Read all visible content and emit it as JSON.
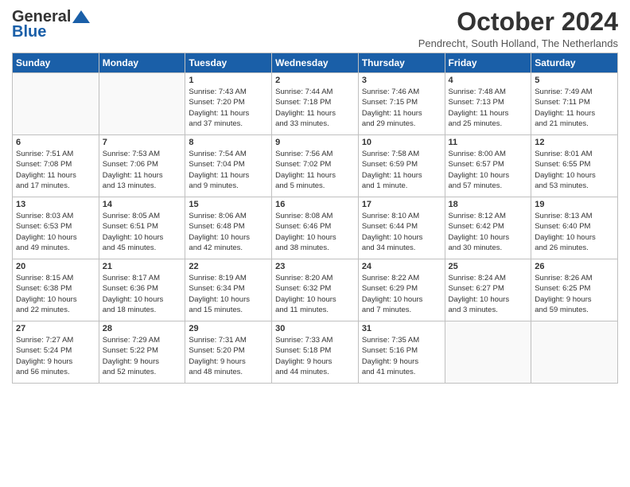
{
  "header": {
    "logo_general": "General",
    "logo_blue": "Blue",
    "month_title": "October 2024",
    "location": "Pendrecht, South Holland, The Netherlands"
  },
  "weekdays": [
    "Sunday",
    "Monday",
    "Tuesday",
    "Wednesday",
    "Thursday",
    "Friday",
    "Saturday"
  ],
  "weeks": [
    [
      {
        "day": "",
        "info": ""
      },
      {
        "day": "",
        "info": ""
      },
      {
        "day": "1",
        "info": "Sunrise: 7:43 AM\nSunset: 7:20 PM\nDaylight: 11 hours\nand 37 minutes."
      },
      {
        "day": "2",
        "info": "Sunrise: 7:44 AM\nSunset: 7:18 PM\nDaylight: 11 hours\nand 33 minutes."
      },
      {
        "day": "3",
        "info": "Sunrise: 7:46 AM\nSunset: 7:15 PM\nDaylight: 11 hours\nand 29 minutes."
      },
      {
        "day": "4",
        "info": "Sunrise: 7:48 AM\nSunset: 7:13 PM\nDaylight: 11 hours\nand 25 minutes."
      },
      {
        "day": "5",
        "info": "Sunrise: 7:49 AM\nSunset: 7:11 PM\nDaylight: 11 hours\nand 21 minutes."
      }
    ],
    [
      {
        "day": "6",
        "info": "Sunrise: 7:51 AM\nSunset: 7:08 PM\nDaylight: 11 hours\nand 17 minutes."
      },
      {
        "day": "7",
        "info": "Sunrise: 7:53 AM\nSunset: 7:06 PM\nDaylight: 11 hours\nand 13 minutes."
      },
      {
        "day": "8",
        "info": "Sunrise: 7:54 AM\nSunset: 7:04 PM\nDaylight: 11 hours\nand 9 minutes."
      },
      {
        "day": "9",
        "info": "Sunrise: 7:56 AM\nSunset: 7:02 PM\nDaylight: 11 hours\nand 5 minutes."
      },
      {
        "day": "10",
        "info": "Sunrise: 7:58 AM\nSunset: 6:59 PM\nDaylight: 11 hours\nand 1 minute."
      },
      {
        "day": "11",
        "info": "Sunrise: 8:00 AM\nSunset: 6:57 PM\nDaylight: 10 hours\nand 57 minutes."
      },
      {
        "day": "12",
        "info": "Sunrise: 8:01 AM\nSunset: 6:55 PM\nDaylight: 10 hours\nand 53 minutes."
      }
    ],
    [
      {
        "day": "13",
        "info": "Sunrise: 8:03 AM\nSunset: 6:53 PM\nDaylight: 10 hours\nand 49 minutes."
      },
      {
        "day": "14",
        "info": "Sunrise: 8:05 AM\nSunset: 6:51 PM\nDaylight: 10 hours\nand 45 minutes."
      },
      {
        "day": "15",
        "info": "Sunrise: 8:06 AM\nSunset: 6:48 PM\nDaylight: 10 hours\nand 42 minutes."
      },
      {
        "day": "16",
        "info": "Sunrise: 8:08 AM\nSunset: 6:46 PM\nDaylight: 10 hours\nand 38 minutes."
      },
      {
        "day": "17",
        "info": "Sunrise: 8:10 AM\nSunset: 6:44 PM\nDaylight: 10 hours\nand 34 minutes."
      },
      {
        "day": "18",
        "info": "Sunrise: 8:12 AM\nSunset: 6:42 PM\nDaylight: 10 hours\nand 30 minutes."
      },
      {
        "day": "19",
        "info": "Sunrise: 8:13 AM\nSunset: 6:40 PM\nDaylight: 10 hours\nand 26 minutes."
      }
    ],
    [
      {
        "day": "20",
        "info": "Sunrise: 8:15 AM\nSunset: 6:38 PM\nDaylight: 10 hours\nand 22 minutes."
      },
      {
        "day": "21",
        "info": "Sunrise: 8:17 AM\nSunset: 6:36 PM\nDaylight: 10 hours\nand 18 minutes."
      },
      {
        "day": "22",
        "info": "Sunrise: 8:19 AM\nSunset: 6:34 PM\nDaylight: 10 hours\nand 15 minutes."
      },
      {
        "day": "23",
        "info": "Sunrise: 8:20 AM\nSunset: 6:32 PM\nDaylight: 10 hours\nand 11 minutes."
      },
      {
        "day": "24",
        "info": "Sunrise: 8:22 AM\nSunset: 6:29 PM\nDaylight: 10 hours\nand 7 minutes."
      },
      {
        "day": "25",
        "info": "Sunrise: 8:24 AM\nSunset: 6:27 PM\nDaylight: 10 hours\nand 3 minutes."
      },
      {
        "day": "26",
        "info": "Sunrise: 8:26 AM\nSunset: 6:25 PM\nDaylight: 9 hours\nand 59 minutes."
      }
    ],
    [
      {
        "day": "27",
        "info": "Sunrise: 7:27 AM\nSunset: 5:24 PM\nDaylight: 9 hours\nand 56 minutes."
      },
      {
        "day": "28",
        "info": "Sunrise: 7:29 AM\nSunset: 5:22 PM\nDaylight: 9 hours\nand 52 minutes."
      },
      {
        "day": "29",
        "info": "Sunrise: 7:31 AM\nSunset: 5:20 PM\nDaylight: 9 hours\nand 48 minutes."
      },
      {
        "day": "30",
        "info": "Sunrise: 7:33 AM\nSunset: 5:18 PM\nDaylight: 9 hours\nand 44 minutes."
      },
      {
        "day": "31",
        "info": "Sunrise: 7:35 AM\nSunset: 5:16 PM\nDaylight: 9 hours\nand 41 minutes."
      },
      {
        "day": "",
        "info": ""
      },
      {
        "day": "",
        "info": ""
      }
    ]
  ]
}
